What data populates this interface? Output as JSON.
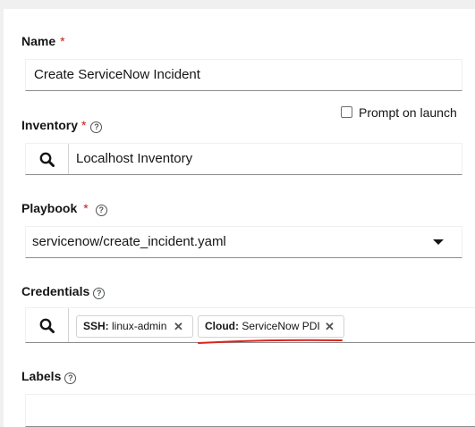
{
  "name": {
    "label": "Name",
    "required_mark": "*",
    "value": "Create ServiceNow Incident"
  },
  "inventory": {
    "label": "Inventory",
    "required_mark": "*",
    "value": "Localhost Inventory",
    "prompt_label": "Prompt on launch",
    "prompt_checked": false
  },
  "playbook": {
    "label": "Playbook",
    "required_mark": "*",
    "value": "servicenow/create_incident.yaml"
  },
  "credentials": {
    "label": "Credentials",
    "chips": [
      {
        "type": "SSH:",
        "name": "linux-admin"
      },
      {
        "type": "Cloud:",
        "name": "ServiceNow PDI"
      }
    ]
  },
  "labels": {
    "label": "Labels",
    "value": ""
  },
  "annotation_color": "#d9251d",
  "help_glyph": "?",
  "remove_glyph": "✕"
}
